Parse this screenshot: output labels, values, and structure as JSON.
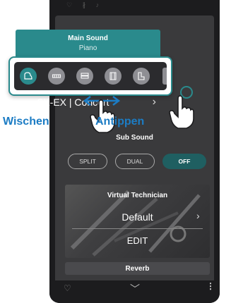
{
  "app": {
    "top_icons": "♡ ∦ ♪"
  },
  "main_sound": {
    "title": "Main Sound",
    "value": "Piano",
    "categories": [
      {
        "name": "grand-piano-icon",
        "active": true
      },
      {
        "name": "electric-piano-icon",
        "active": false
      },
      {
        "name": "organ-icon",
        "active": false
      },
      {
        "name": "harpsichord-icon",
        "active": false
      },
      {
        "name": "upright-piano-icon",
        "active": false
      }
    ],
    "instrument_name": "SK-EX | Concert",
    "chevron": "›"
  },
  "annotations": {
    "swipe_label": "Wischen",
    "tap_label": "Antippen",
    "color": "#1c7cc4"
  },
  "sub_sound": {
    "title": "Sub Sound",
    "split_label": "SPLIT",
    "dual_label": "DUAL",
    "off_label": "OFF"
  },
  "virtual_technician": {
    "title": "Virtual Technician",
    "value": "Default",
    "chevron": "›",
    "edit_label": "EDIT"
  },
  "reverb": {
    "title": "Reverb"
  },
  "bottom_bar": {
    "heart": "♡",
    "chevron": "﹀",
    "menu": "⋮"
  },
  "colors": {
    "accent": "#2a8a8c",
    "annotation": "#1c7cc4"
  }
}
